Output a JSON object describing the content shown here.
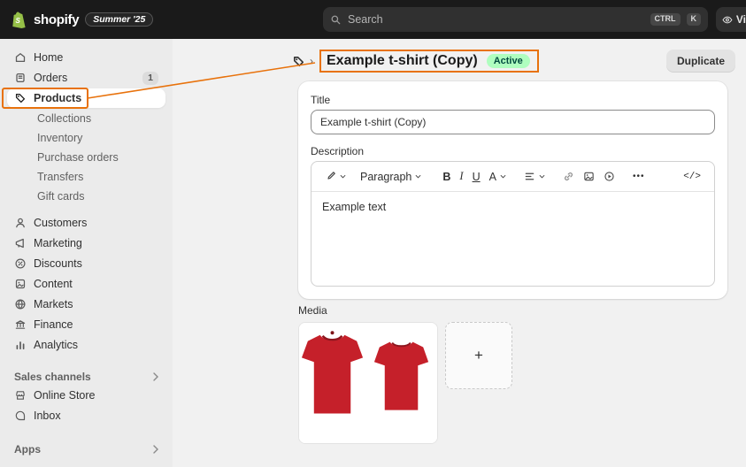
{
  "colors": {
    "annotation": "#E8720C",
    "topbar_bg": "#1a1a1a",
    "sidebar_bg": "#ebebeb",
    "main_bg": "#f1f1f1",
    "shopify_green": "#95BF47",
    "active_badge_bg": "#AFFEBF",
    "active_badge_text": "#014B40",
    "tshirt_red": "#C5202A"
  },
  "topbar": {
    "logo_letter": "S",
    "logo_text": "shopify",
    "edition_badge": "Summer '25",
    "search": {
      "placeholder": "Search",
      "shortcut_keys": [
        "CTRL",
        "K"
      ]
    },
    "view_button_label": "Vi"
  },
  "sidebar": {
    "items": [
      {
        "label": "Home",
        "icon": "home"
      },
      {
        "label": "Orders",
        "icon": "orders",
        "badge": "1"
      },
      {
        "label": "Products",
        "icon": "tag",
        "selected": true
      },
      {
        "label": "Collections",
        "sub": true
      },
      {
        "label": "Inventory",
        "sub": true
      },
      {
        "label": "Purchase orders",
        "sub": true
      },
      {
        "label": "Transfers",
        "sub": true
      },
      {
        "label": "Gift cards",
        "sub": true
      },
      {
        "label": "Customers",
        "icon": "person"
      },
      {
        "label": "Marketing",
        "icon": "megaphone"
      },
      {
        "label": "Discounts",
        "icon": "percent"
      },
      {
        "label": "Content",
        "icon": "page-image"
      },
      {
        "label": "Markets",
        "icon": "globe"
      },
      {
        "label": "Finance",
        "icon": "bank"
      },
      {
        "label": "Analytics",
        "icon": "bar-chart"
      }
    ],
    "sales_channels": {
      "label": "Sales channels",
      "items": [
        {
          "label": "Online Store",
          "icon": "storefront"
        },
        {
          "label": "Inbox",
          "icon": "chat-bubble"
        }
      ]
    },
    "apps": {
      "label": "Apps"
    }
  },
  "page": {
    "breadcrumb_icon": "tag",
    "breadcrumb_separator": "›",
    "title": "Example t-shirt (Copy)",
    "status": "Active",
    "duplicate_button": "Duplicate"
  },
  "form": {
    "title_label": "Title",
    "title_value": "Example t-shirt (Copy)",
    "description_label": "Description",
    "editor": {
      "toolbar_icons": [
        "format-brush",
        "paragraph-style",
        "bold",
        "italic",
        "underline",
        "text-color",
        "text-align",
        "link",
        "image",
        "video",
        "more-dots",
        "code-view"
      ],
      "style_dropdown": "Paragraph",
      "bold_label": "B",
      "italic_label": "I",
      "underline_label": "U",
      "color_label": "A",
      "more_label": "•••",
      "code_label": "</>",
      "content": "Example text"
    },
    "media_label": "Media",
    "add_media_label": "+"
  }
}
